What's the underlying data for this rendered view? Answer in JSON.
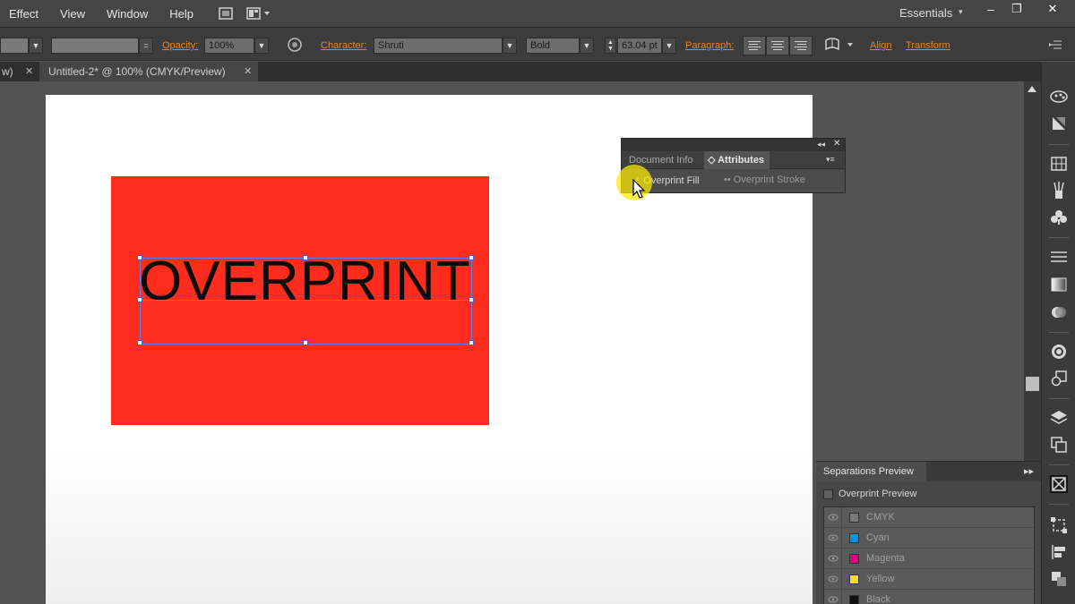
{
  "menu": [
    "Effect",
    "View",
    "Window",
    "Help"
  ],
  "workspace": "Essentials",
  "window_controls": {
    "minimize": "–",
    "restore": "❐",
    "close": "✕"
  },
  "controlbar": {
    "opacity_label": "Opacity:",
    "opacity_value": "100%",
    "character_label": "Character:",
    "font_family": "Shruti",
    "font_style": "Bold",
    "font_size": "63.04 pt",
    "paragraph_label": "Paragraph:",
    "align_label": "Align",
    "transform_label": "Transform"
  },
  "tabs": {
    "prev_tab": "w)",
    "active_tab": "Untitled-2* @ 100% (CMYK/Preview)"
  },
  "artboard": {
    "text": "OVERPRINT",
    "rect_color": "#ff2b1c"
  },
  "attributes_panel": {
    "tab_document_info": "Document Info",
    "tab_attributes": "Attributes",
    "overprint_fill": "Overprint Fill",
    "overprint_stroke": "Overprint Stroke"
  },
  "separations": {
    "title": "Separations Preview",
    "overprint_preview": "Overprint Preview",
    "plates": [
      {
        "name": "CMYK",
        "color": "#7a7a7a"
      },
      {
        "name": "Cyan",
        "color": "#0095e0"
      },
      {
        "name": "Magenta",
        "color": "#e0007a"
      },
      {
        "name": "Yellow",
        "color": "#ffe000"
      },
      {
        "name": "Black",
        "color": "#111111"
      }
    ]
  }
}
